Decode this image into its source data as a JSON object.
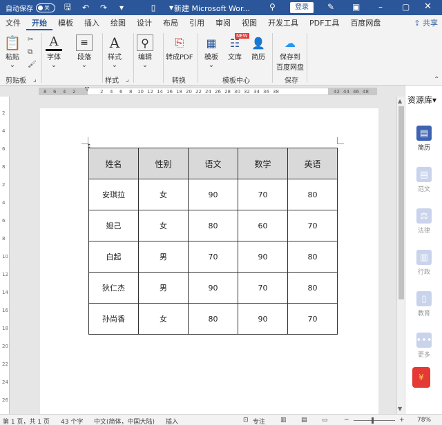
{
  "titlebar": {
    "autosave_label": "自动保存",
    "autosave_state": "关",
    "doc_title": "新建 Microsoft Wor...",
    "login": "登录"
  },
  "menu": {
    "items": [
      "文件",
      "开始",
      "模板",
      "插入",
      "绘图",
      "设计",
      "布局",
      "引用",
      "审阅",
      "视图",
      "开发工具",
      "PDF工具",
      "百度网盘"
    ],
    "active": "开始",
    "share": "共享"
  },
  "ribbon": {
    "paste": "粘贴",
    "font": "字体",
    "paragraph": "段落",
    "styles": "样式",
    "editing": "编辑",
    "to_pdf": "转成PDF",
    "template": "模板",
    "wenku": "文库",
    "resume": "简历",
    "save_baidu": "保存到\n百度网盘",
    "new_badge": "NEW",
    "groups": {
      "clipboard": "剪贴板",
      "styles": "样式",
      "convert": "转换",
      "template_center": "模板中心",
      "save": "保存"
    }
  },
  "ruler": {
    "labels": [
      "8",
      "6",
      "4",
      "2",
      "2",
      "4",
      "6",
      "8",
      "10",
      "12",
      "14",
      "16",
      "18",
      "20",
      "22",
      "24",
      "26",
      "28",
      "30",
      "32",
      "34",
      "36",
      "38",
      "42",
      "44",
      "46",
      "48"
    ]
  },
  "vruler": {
    "labels": [
      "2",
      "4",
      "6",
      "8",
      "2",
      "4",
      "6",
      "8",
      "10",
      "12",
      "14",
      "16",
      "18",
      "20",
      "22",
      "24",
      "26"
    ]
  },
  "table": {
    "rows": [
      [
        "姓名",
        "性别",
        "语文",
        "数学",
        "英语"
      ],
      [
        "安琪拉",
        "女",
        "90",
        "70",
        "80"
      ],
      [
        "妲己",
        "女",
        "80",
        "60",
        "70"
      ],
      [
        "白起",
        "男",
        "70",
        "90",
        "80"
      ],
      [
        "狄仁杰",
        "男",
        "90",
        "70",
        "80"
      ],
      [
        "孙尚香",
        "女",
        "80",
        "90",
        "70"
      ]
    ]
  },
  "sidepane": {
    "title": "资源库",
    "items": [
      "简历",
      "范文",
      "法律",
      "行政",
      "教育",
      "更多"
    ]
  },
  "status": {
    "page": "第 1 页，共 1 页",
    "words": "43 个字",
    "lang": "中文(简体，中国大陆)",
    "insert": "插入",
    "focus": "专注",
    "zoom": "78%"
  }
}
